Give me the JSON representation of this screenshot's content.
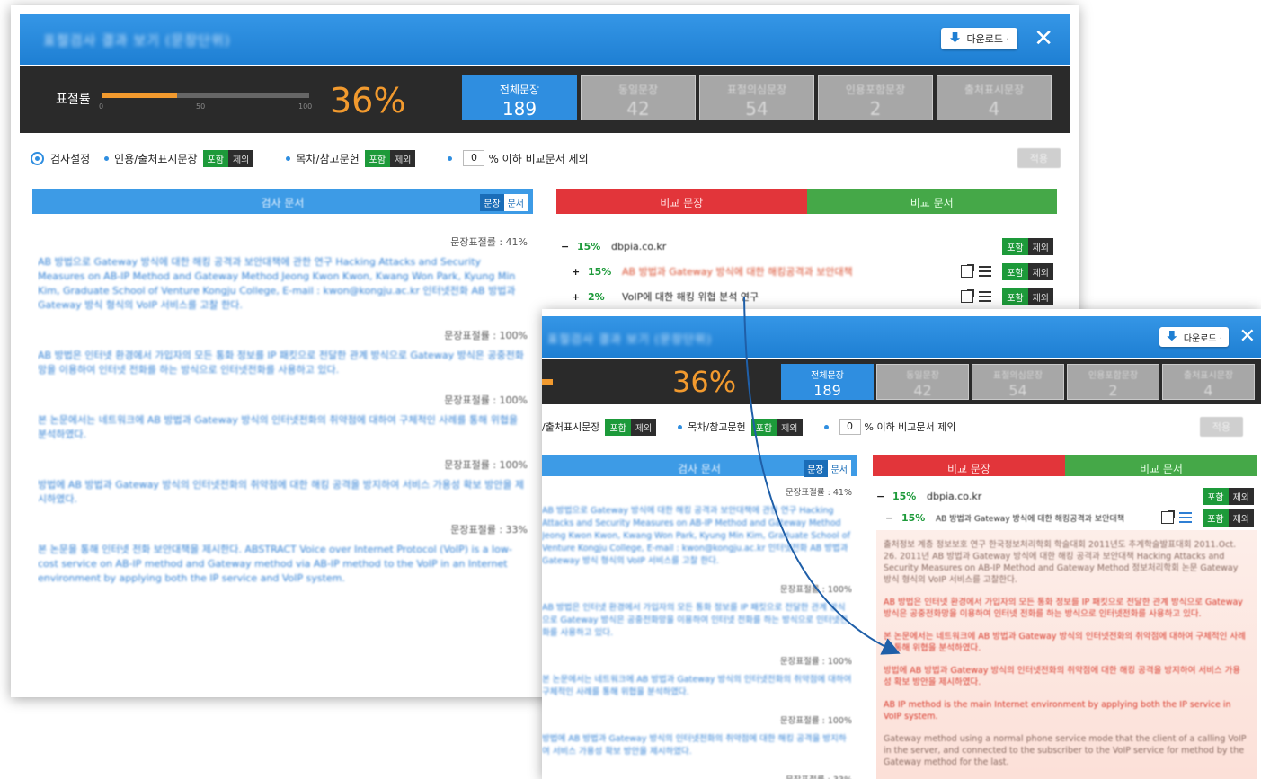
{
  "window": {
    "title": "표절검사 결과 보기 (문장단위)",
    "download_label": "다운로드 ·",
    "close_glyph": "✕"
  },
  "stats": {
    "plagiarism_label": "표절률",
    "gauge_ticks": [
      "0",
      "50",
      "100"
    ],
    "rate_text": "36%",
    "rate_value": 36,
    "tabs": [
      {
        "label": "전체문장",
        "count": "189"
      },
      {
        "label": "동일문장",
        "count": "42"
      },
      {
        "label": "표절의심문장",
        "count": "54"
      },
      {
        "label": "인용포함문장",
        "count": "2"
      },
      {
        "label": "출처표시문장",
        "count": "4"
      }
    ]
  },
  "settings": {
    "title": "검사설정",
    "citation_label": "인용/출처표시문장",
    "citation_label_w2": "/출처표시문장",
    "reference_label": "목차/참고문헌",
    "toggle_include": "포함",
    "toggle_exclude": "제외",
    "threshold_value": "0",
    "threshold_suffix": "% 이하 비교문서 제외",
    "apply_label": "적용"
  },
  "left_panel": {
    "title": "검사 문서",
    "toggle_sentence": "문장",
    "toggle_document": "문서",
    "blocks": [
      {
        "rate": "문장표절률 : 41%",
        "text": "AB 방법으로 Gateway 방식에 대한 해킹 공격과 보안대책에 관한 연구 Hacking Attacks and Security Measures on AB-IP Method and Gateway Method Jeong Kwon Kwon, Kwang Won Park, Kyung Min Kim, Graduate School of Venture Kongju College, E-mail : kwon@kongju.ac.kr 인터넷전화 AB 방법과 Gateway 방식 형식의 VoIP 서비스를 고찰 한다."
      },
      {
        "rate": "문장표절률 : 100%",
        "text": "AB 방법은 인터넷 환경에서 가입자의 모든 통화 정보를 IP 패킷으로 전달한 관계 방식으로 Gateway 방식은 공중전화망을 이용하여 인터넷 전화를 하는 방식으로 인터넷전화를 사용하고 있다."
      },
      {
        "rate": "문장표절률 : 100%",
        "text": "본 논문에서는 네트워크에 AB 방법과 Gateway 방식의 인터넷전화의 취약점에 대하여 구체적인 사례를 통해 위협을 분석하였다."
      },
      {
        "rate": "문장표절률 : 100%",
        "text": "방법에 AB 방법과 Gateway 방식의 인터넷전화의 취약점에 대한 해킹 공격을 방지하여 서비스 가용성 확보 방안을 제시하였다."
      },
      {
        "rate": "문장표절률 : 33%",
        "text": "본 논문을 통해 인터넷 전화 보안대책을 제시한다. ABSTRACT Voice over Internet Protocol (VoIP) is a low-cost service on AB-IP method and Gateway method via AB-IP method to the VoIP in an Internet environment by applying both the IP service and VoIP system."
      }
    ]
  },
  "right_panel": {
    "compare_sentence": "비교 문장",
    "compare_document": "비교 문서",
    "rows": [
      {
        "sign": "−",
        "pct": "15%",
        "source": "dbpia.co.kr"
      },
      {
        "sign": "+",
        "pct": "15%",
        "source": "AB 방법과 Gateway 방식에 대한 해킹공격과 보안대책"
      },
      {
        "sign": "+",
        "pct": "2%",
        "source": "VoIP에 대한 해킹 위협 분석 연구"
      }
    ],
    "rows_w2": [
      {
        "sign": "−",
        "pct": "15%",
        "source": "dbpia.co.kr"
      },
      {
        "sign": "−",
        "pct": "15%",
        "source": "AB 방법과 Gateway 방식에 대한 해킹공격과 보안대책"
      }
    ],
    "compare_paragraphs": [
      "출처정보 계층 정보보호 연구 한국정보처리학회 학술대회 2011년도 추계학술발표대회 2011.Oct. 26. 2011년 AB 방법과 Gateway 방식에 대한 해킹 공격과 보안대책 Hacking Attacks and Security Measures on AB-IP Method and Gateway Method 정보처리학회 논문 Gateway 방식 형식의 VoIP 서비스를 고찰한다.",
      "AB 방법은 인터넷 환경에서 가입자의 모든 통화 정보를 IP 패킷으로 전달한 관계 방식으로 Gateway 방식은 공중전화망을 이용하여 인터넷 전화를 하는 방식으로 인터넷전화를 사용하고 있다.",
      "본 논문에서는 네트워크에 AB 방법과 Gateway 방식의 인터넷전화의 취약점에 대하여 구체적인 사례를 통해 위협을 분석하였다.",
      "방법에 AB 방법과 Gateway 방식의 인터넷전화의 취약점에 대한 해킹 공격을 방지하여 서비스 가용성 확보 방안을 제시하였다.",
      "AB IP method is the main Internet environment by applying both the IP service in VoIP system.",
      "Gateway method using a normal phone service mode that the client of a calling VoIP in the server, and connected to the subscriber to the VoIP service for method by the Gateway method for the last."
    ]
  },
  "colors": {
    "accent_blue": "#2f8ee0",
    "orange": "#f29a2e",
    "green": "#1d9a3a",
    "red": "#e2353a"
  }
}
